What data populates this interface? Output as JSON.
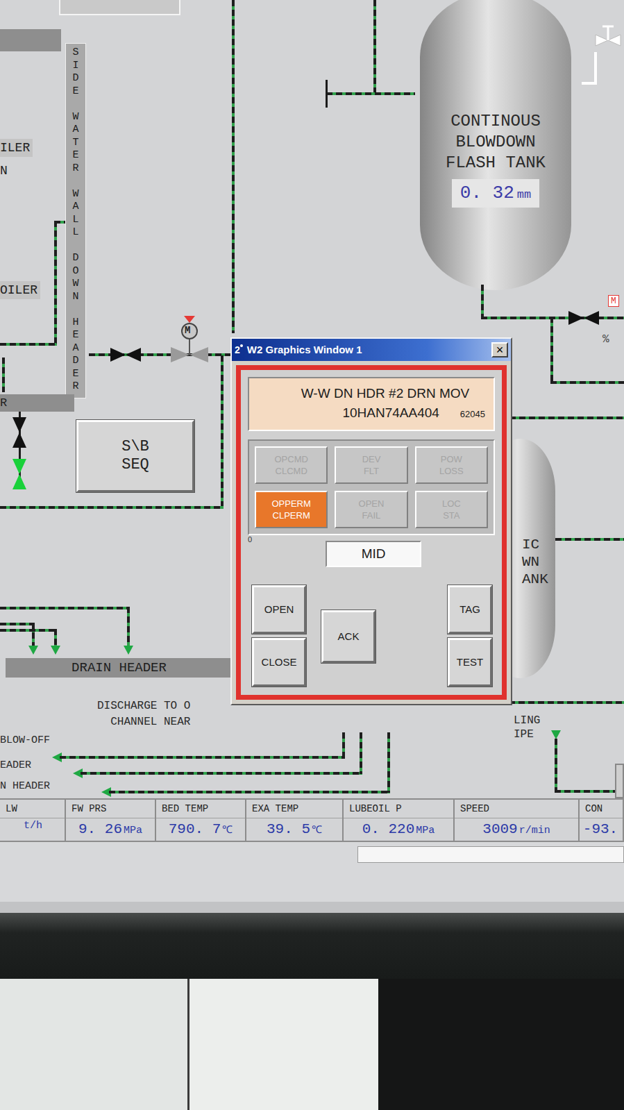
{
  "diagram": {
    "boiler_label_1": "ILER",
    "boiler_label_2": "N",
    "boiler_label_3": "OILER",
    "header_label": "R",
    "downcomer_label": "SIDE WATER WALL DOWN HEADER",
    "flash_tank": {
      "name_lines": [
        "CONTINOUS",
        "BLOWDOWN",
        "FLASH TANK"
      ],
      "value": "0. 32",
      "unit": "mm"
    },
    "sb_seq_button": [
      "S\\B",
      "SEQ"
    ],
    "motor_valve": {
      "symbol": "M",
      "state": "mid",
      "alarm": true
    },
    "valves": [
      {
        "state": "closed"
      },
      {
        "state": "closed"
      },
      {
        "state": "open"
      },
      {
        "state": "closed"
      }
    ],
    "right_tank_lines": [
      "IC",
      "WN",
      "ANK"
    ],
    "drain_header": "DRAIN HEADER",
    "discharge_lines": [
      "DISCHARGE TO O",
      "CHANNEL NEAR"
    ],
    "outlet_labels": [
      "BLOW-OFF",
      "EADER",
      "N HEADER"
    ],
    "pipe_labels": [
      "LING",
      "IPE"
    ],
    "percent": "%",
    "red_tag": "M"
  },
  "popup": {
    "title_icon": "2",
    "title": "W2 Graphics Window 1",
    "close": "×",
    "device_name": "W-W DN HDR #2 DRN MOV",
    "tag": "10HAN74AA404",
    "id": "62045",
    "indicators": [
      {
        "lines": [
          "OPCMD",
          "CLCMD"
        ],
        "active": false
      },
      {
        "lines": [
          "DEV",
          "FLT"
        ],
        "active": false
      },
      {
        "lines": [
          "POW",
          "LOSS"
        ],
        "active": false
      },
      {
        "lines": [
          "OPPERM",
          "CLPERM"
        ],
        "active": true
      },
      {
        "lines": [
          "OPEN",
          "FAIL"
        ],
        "active": false
      },
      {
        "lines": [
          "LOC",
          "STA"
        ],
        "active": false
      }
    ],
    "side_mark": "0",
    "position": "MID",
    "open_button": "OPEN",
    "close_button": "CLOSE",
    "ack_button": "ACK",
    "tag_button": "TAG",
    "test_button": "TEST"
  },
  "status_bar": [
    {
      "label": "LW",
      "value": "",
      "unit": "t/h"
    },
    {
      "label": "FW PRS",
      "value": "9. 26",
      "unit": "MPa"
    },
    {
      "label": "BED TEMP",
      "value": "790. 7",
      "unit": "℃"
    },
    {
      "label": "EXA TEMP",
      "value": "39. 5",
      "unit": "℃"
    },
    {
      "label": "LUBEOIL P",
      "value": "0. 220",
      "unit": "MPa"
    },
    {
      "label": "SPEED",
      "value": "3009",
      "unit": "r/min"
    },
    {
      "label": "CON",
      "value": "-93.",
      "unit": ""
    }
  ]
}
